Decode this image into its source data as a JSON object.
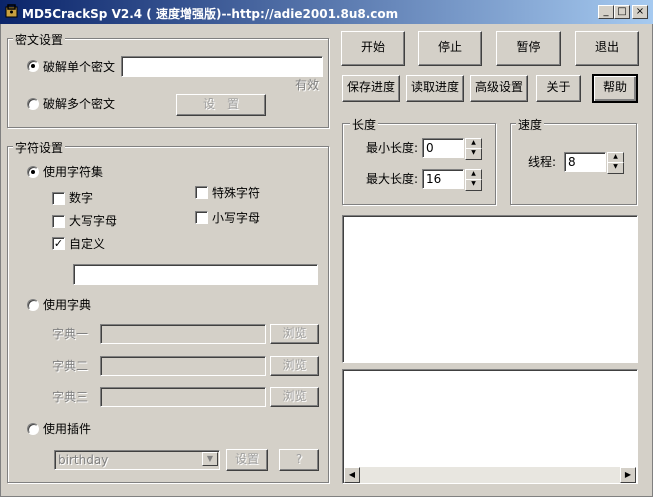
{
  "window": {
    "title": "MD5CrackSp V2.4 ( 速度增强版)--http://adie2001.8u8.com",
    "minimize": "_",
    "maximize": "□",
    "close": "×"
  },
  "cipher": {
    "group_label": "密文设置",
    "single_label": "破解单个密文",
    "single_value": "",
    "valid_text": "有效",
    "multi_label": "破解多个密文",
    "set_button": "设　置",
    "mode": "single"
  },
  "charset": {
    "group_label": "字符设置",
    "use_charset_label": "使用字符集",
    "digits": {
      "label": "数字",
      "checked": false
    },
    "special": {
      "label": "特殊字符",
      "checked": false
    },
    "upper": {
      "label": "大写字母",
      "checked": false
    },
    "lower": {
      "label": "小写字母",
      "checked": false
    },
    "custom": {
      "label": "自定义",
      "checked": true
    },
    "custom_value": "",
    "use_dict_label": "使用字典",
    "dict1_label": "字典一",
    "dict2_label": "字典二",
    "dict3_label": "字典三",
    "browse": "浏览",
    "use_plugin_label": "使用插件",
    "plugin_value": "birthday",
    "plugin_set": "设置",
    "plugin_help": "?",
    "check_mark": "✓",
    "dropdown_arrow": "▼"
  },
  "actions": {
    "start": "开始",
    "stop": "停止",
    "pause": "暂停",
    "exit": "退出",
    "save_progress": "保存进度",
    "load_progress": "读取进度",
    "advanced": "高级设置",
    "about": "关于",
    "help": "帮助"
  },
  "length": {
    "group_label": "长度",
    "min_label": "最小长度:",
    "min_value": "0",
    "max_label": "最大长度:",
    "max_value": "16"
  },
  "speed": {
    "group_label": "速度",
    "threads_label": "线程:",
    "threads_value": "8"
  },
  "scroll": {
    "left": "◀",
    "right": "▶"
  },
  "spin": {
    "up": "▲",
    "down": "▼"
  }
}
